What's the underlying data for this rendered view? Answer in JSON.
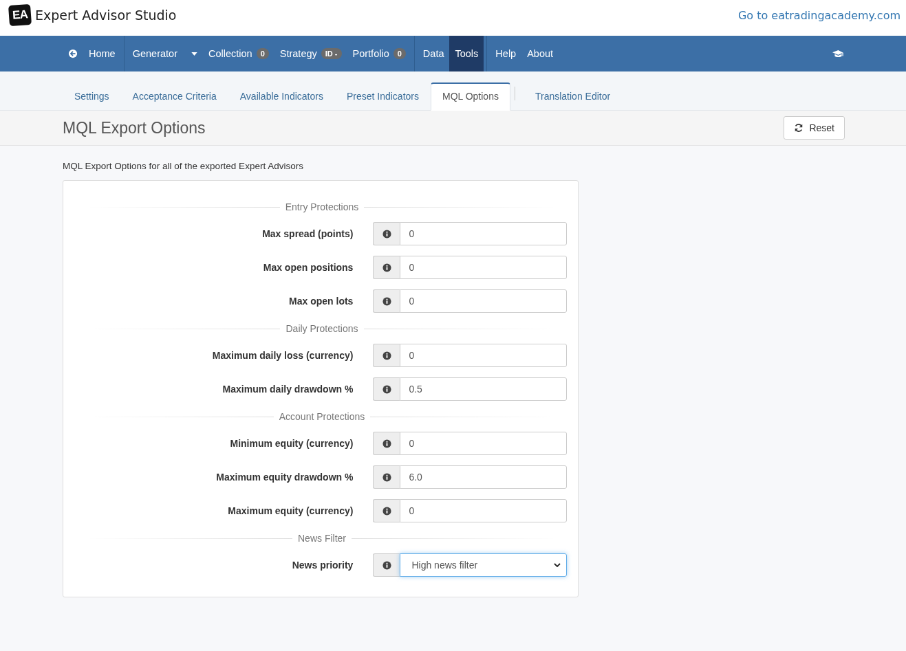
{
  "header": {
    "logo_mark": "EA",
    "app_name": "Expert Advisor Studio",
    "site_link": "Go to eatradingacademy.com"
  },
  "nav": [
    {
      "label": "Home",
      "kind": "home",
      "selected": false,
      "separator_before": false
    },
    {
      "label": "Generator",
      "kind": "dropdown",
      "selected": false,
      "separator_before": true
    },
    {
      "label": "Collection",
      "kind": "badge",
      "badge": "0",
      "selected": false,
      "separator_before": false
    },
    {
      "label": "Strategy",
      "kind": "badge",
      "badge": "ID -",
      "selected": false,
      "separator_before": false
    },
    {
      "label": "Portfolio",
      "kind": "badge",
      "badge": "0",
      "selected": false,
      "separator_before": false
    },
    {
      "label": "Data",
      "kind": "link",
      "selected": false,
      "separator_before": true
    },
    {
      "label": "Tools",
      "kind": "link",
      "selected": true,
      "separator_before": false
    },
    {
      "label": "Help",
      "kind": "link",
      "selected": false,
      "separator_before": true
    },
    {
      "label": "About",
      "kind": "link",
      "selected": false,
      "separator_before": false
    }
  ],
  "tabs": [
    {
      "label": "Settings",
      "selected": false
    },
    {
      "label": "Acceptance Criteria",
      "selected": false
    },
    {
      "label": "Available Indicators",
      "selected": false
    },
    {
      "label": "Preset Indicators",
      "selected": false
    },
    {
      "label": "MQL Options",
      "selected": true
    },
    {
      "label": "Translation Editor",
      "selected": false
    }
  ],
  "page": {
    "title": "MQL Export Options",
    "reset_button": "Reset",
    "description": "MQL Export Options for all of the exported Expert Advisors"
  },
  "sections": [
    {
      "title": "Entry Protections",
      "fields": [
        {
          "label": "Max spread (points)",
          "kind": "input",
          "value": "0",
          "focused": false
        },
        {
          "label": "Max open positions",
          "kind": "input",
          "value": "0",
          "focused": false
        },
        {
          "label": "Max open lots",
          "kind": "input",
          "value": "0",
          "focused": false
        }
      ]
    },
    {
      "title": "Daily Protections",
      "fields": [
        {
          "label": "Maximum daily loss (currency)",
          "kind": "input",
          "value": "0",
          "focused": false
        },
        {
          "label": "Maximum daily drawdown %",
          "kind": "input",
          "value": "0.5",
          "focused": false
        }
      ]
    },
    {
      "title": "Account Protections",
      "fields": [
        {
          "label": "Minimum equity (currency)",
          "kind": "input",
          "value": "0",
          "focused": false
        },
        {
          "label": "Maximum equity drawdown %",
          "kind": "input",
          "value": "6.0",
          "focused": false
        },
        {
          "label": "Maximum equity (currency)",
          "kind": "input",
          "value": "0",
          "focused": false
        }
      ]
    },
    {
      "title": "News Filter",
      "fields": [
        {
          "label": "News priority",
          "kind": "select",
          "value": "High news filter",
          "focused": true
        }
      ]
    }
  ]
}
